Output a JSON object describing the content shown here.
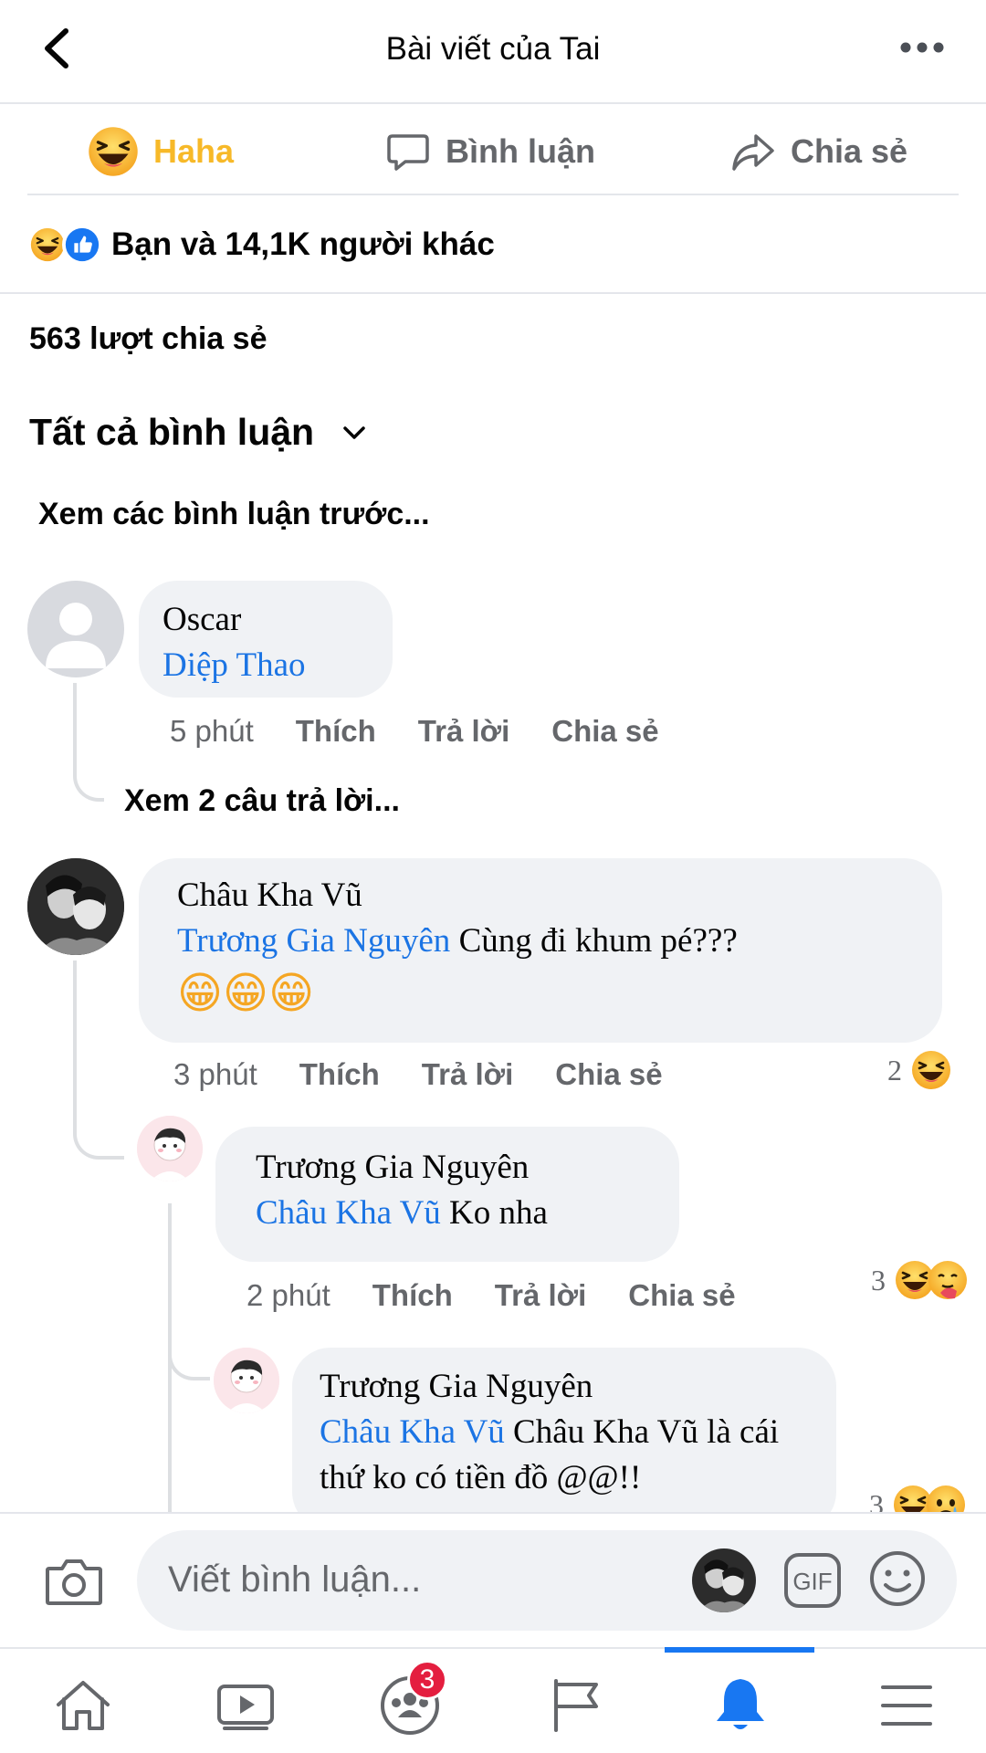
{
  "header": {
    "title": "Bài viết của Tai",
    "back_icon": "chevron-left-icon",
    "more_icon": "more-dots-icon"
  },
  "actions": {
    "haha_label": "Haha",
    "comment_label": "Bình luận",
    "share_label": "Chia sẻ"
  },
  "reactions": {
    "summary": "Bạn và 14,1K người khác"
  },
  "shares": {
    "count_text": "563 lượt chia sẻ"
  },
  "comments_section": {
    "filter_label": "Tất cả bình luận",
    "previous_link": "Xem các bình luận trước..."
  },
  "comments": [
    {
      "author": "Oscar",
      "mention": "Diệp Thao",
      "text": "",
      "time": "5 phút",
      "like": "Thích",
      "reply": "Trả lời",
      "share": "Chia sẻ",
      "see_replies": "Xem 2 câu trả lời..."
    },
    {
      "author": "Châu Kha Vũ",
      "mention": "Trương Gia Nguyên",
      "text": " Cùng đi khum pé???",
      "emoji": "😁😁😁",
      "time": "3 phút",
      "like": "Thích",
      "reply": "Trả lời",
      "share": "Chia sẻ",
      "reaction_count": "2"
    }
  ],
  "replies": [
    {
      "author": "Trương Gia Nguyên",
      "mention": "Châu Kha Vũ",
      "text": " Ko nha",
      "time": "2 phút",
      "like": "Thích",
      "reply": "Trả lời",
      "share": "Chia sẻ",
      "reaction_count": "3"
    },
    {
      "author": "Trương Gia Nguyên",
      "mention": "Châu Kha Vũ",
      "text": " Châu Kha Vũ là cái thứ ko có tiền đồ @@!!",
      "reaction_count": "3"
    }
  ],
  "composer": {
    "placeholder": "Viết bình luận...",
    "gif_label": "GIF"
  },
  "bottom_nav": {
    "groups_badge": "3"
  },
  "colors": {
    "mention_blue": "#1b74e4",
    "haha_yellow": "#f7b928",
    "like_blue": "#1877f2",
    "badge_red": "#e41e3f",
    "bubble_gray": "#f0f2f5"
  }
}
